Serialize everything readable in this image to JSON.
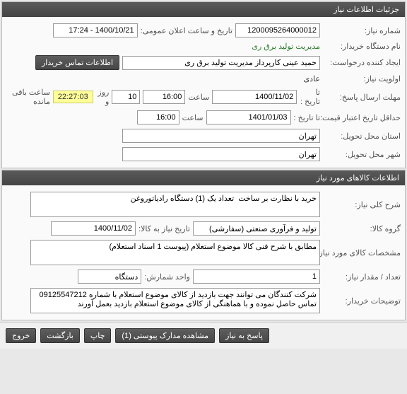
{
  "panels": {
    "need_details_title": "جزئیات اطلاعات نیاز",
    "need_items_title": "اطلاعات کالاهای مورد نیاز"
  },
  "labels": {
    "need_number": "شماره نیاز:",
    "announce_datetime": "تاریخ و ساعت اعلان عمومی:",
    "buyer_org": "نام دستگاه خریدار:",
    "requester": "ایجاد کننده درخواست:",
    "contact_info_btn": "اطلاعات تماس خریدار",
    "priority": "اولویت نیاز:",
    "response_deadline": "مهلت ارسال پاسخ:",
    "to_date": "تا تاریخ :",
    "time": "ساعت",
    "days_and": "روز و",
    "time_remaining": "ساعت باقی مانده",
    "price_validity": "حداقل تاریخ اعتبار قیمت:",
    "delivery_province": "استان محل تحویل:",
    "delivery_city": "شهر محل تحویل:",
    "need_desc": "شرح کلی نیاز:",
    "item_group": "گروه کالا:",
    "need_date": "تاریخ نیاز به کالا:",
    "item_spec": "مشخصات کالای مورد نیاز:",
    "qty": "تعداد / مقدار نیاز:",
    "unit": "واحد شمارش:",
    "buyer_notes": "توضیحات خریدار:"
  },
  "values": {
    "need_number": "1200095264000012",
    "announce_datetime": "1400/10/21 - 17:24",
    "buyer_org": "مدیریت تولید برق ری",
    "requester": "حمید عینی کارپرداز مدیریت تولید برق ری",
    "priority": "عادی",
    "deadline_date": "1400/11/02",
    "deadline_time": "16:00",
    "days_remaining": "10",
    "countdown": "22:27:03",
    "validity_date": "1401/01/03",
    "validity_time": "16:00",
    "province": "تهران",
    "city": "تهران",
    "need_desc": "خرید با نظارت بر ساخت  تعداد یک (1) دستگاه رادیاتوروغن",
    "item_group": "تولید و فرآوری صنعتی (سفارشی)",
    "need_date": "1400/11/02",
    "item_spec": "مطابق با شرح فنی کالا موضوع استعلام (پیوست 1 اسناد استعلام)",
    "qty": "1",
    "unit": "دستگاه",
    "buyer_notes": "شرکت کنندگان می توانند جهت بازدید از کالای موضوع استعلام با شماره 09125547212 تماس حاصل نموده و با هماهنگی از کالای موضوع استعلام بازدید بعمل آورند"
  },
  "buttons": {
    "respond": "پاسخ به نیاز",
    "attachments": "مشاهده مدارک پیوستی (1)",
    "print": "چاپ",
    "back": "بازگشت",
    "exit": "خروج"
  }
}
